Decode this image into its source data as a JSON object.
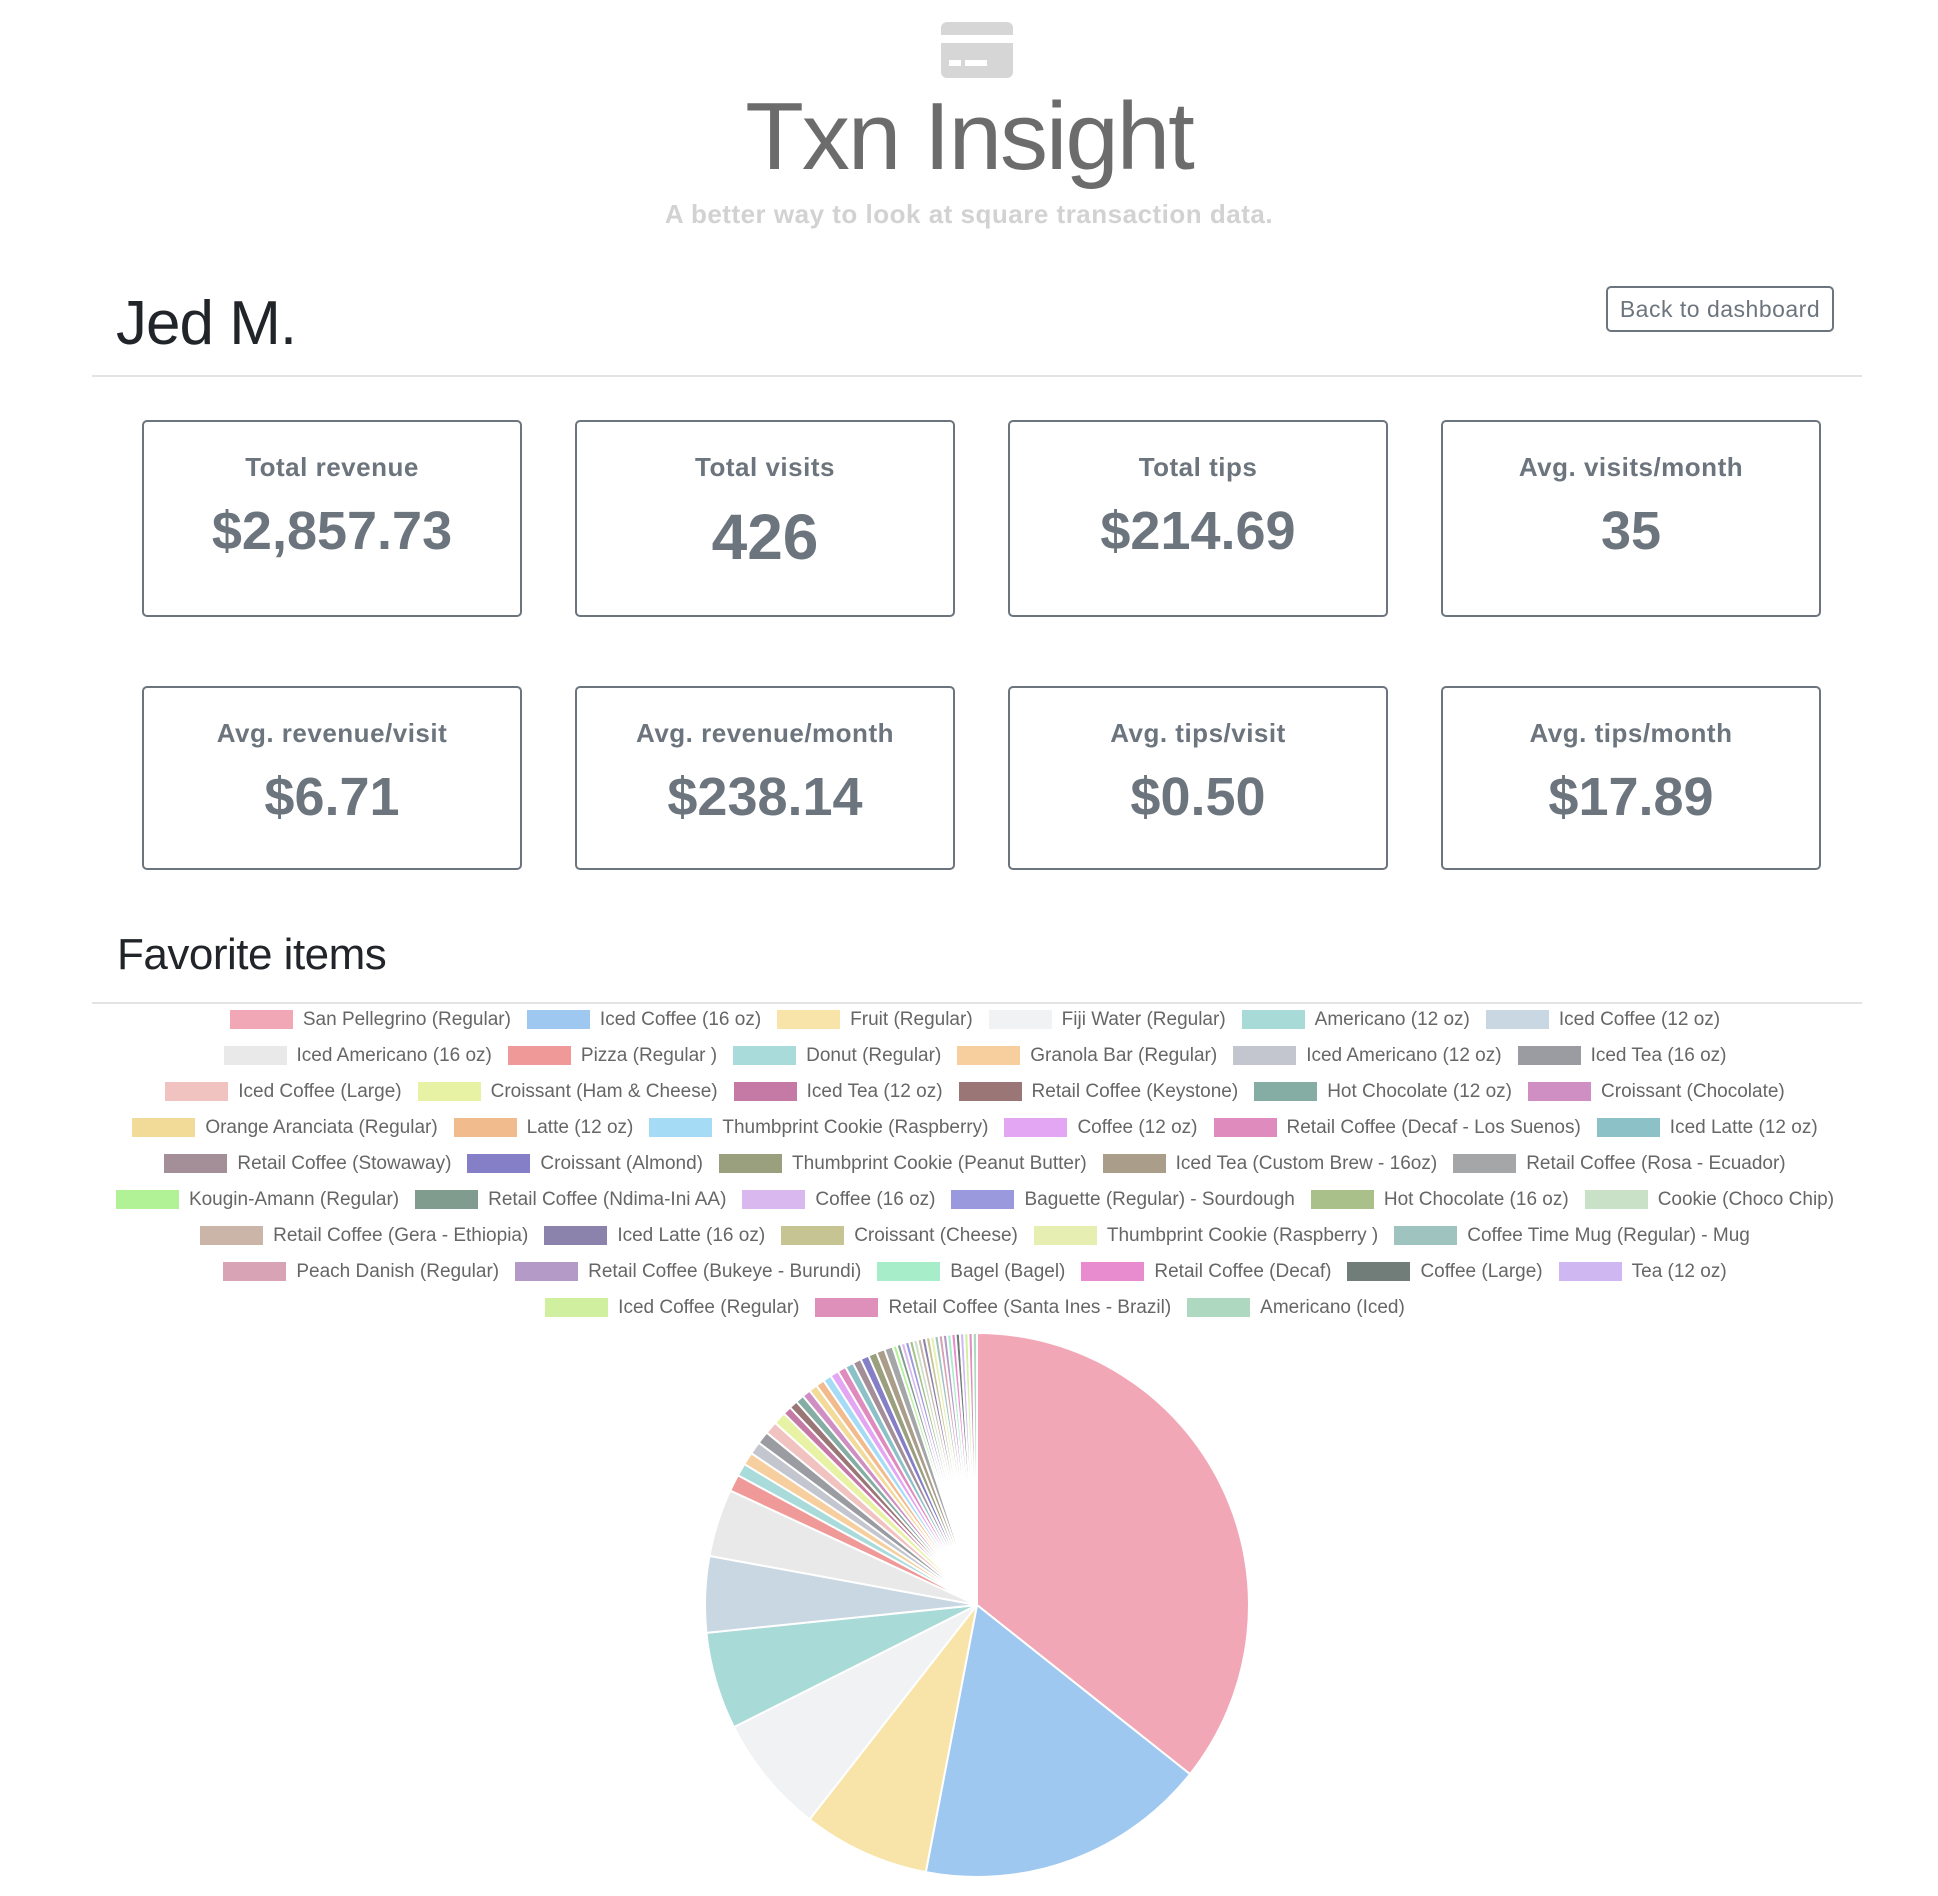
{
  "header": {
    "logo_icon": "credit-card-icon",
    "title": "Txn Insight",
    "subtitle": "A better way to look at square transaction data."
  },
  "customer": {
    "name": "Jed M.",
    "back_label": "Back to dashboard"
  },
  "stats": [
    {
      "label": "Total revenue",
      "value": "$2,857.73"
    },
    {
      "label": "Total visits",
      "value": "426"
    },
    {
      "label": "Total tips",
      "value": "$214.69"
    },
    {
      "label": "Avg. visits/month",
      "value": "35"
    },
    {
      "label": "Avg. revenue/visit",
      "value": "$6.71"
    },
    {
      "label": "Avg. revenue/month",
      "value": "$238.14"
    },
    {
      "label": "Avg. tips/visit",
      "value": "$0.50"
    },
    {
      "label": "Avg. tips/month",
      "value": "$17.89"
    }
  ],
  "favorites": {
    "title": "Favorite items"
  },
  "chart_data": {
    "type": "pie",
    "legend_position": "top",
    "categories": [
      "San Pellegrino (Regular)",
      "Iced Coffee (16 oz)",
      "Fruit (Regular)",
      "Fiji Water (Regular)",
      "Americano (12 oz)",
      "Iced Coffee (12 oz)",
      "Iced Americano (16 oz)",
      "Pizza (Regular )",
      "Donut (Regular)",
      "Granola Bar (Regular)",
      "Iced Americano (12 oz)",
      "Iced Tea (16 oz)",
      "Iced Coffee (Large)",
      "Croissant (Ham & Cheese)",
      "Iced Tea (12 oz)",
      "Retail Coffee (Keystone)",
      "Hot Chocolate (12 oz)",
      "Croissant (Chocolate)",
      "Orange Aranciata (Regular)",
      "Latte (12 oz)",
      "Thumbprint Cookie (Raspberry)",
      "Coffee (12 oz)",
      "Retail Coffee (Decaf - Los Suenos)",
      "Iced Latte (12 oz)",
      "Retail Coffee (Stowaway)",
      "Croissant (Almond)",
      "Thumbprint Cookie (Peanut Butter)",
      "Iced Tea (Custom Brew - 16oz)",
      "Retail Coffee (Rosa - Ecuador)",
      "Kougin-Amann (Regular)",
      "Retail Coffee (Ndima-Ini AA)",
      "Coffee (16 oz)",
      "Baguette (Regular) - Sourdough",
      "Hot Chocolate (16 oz)",
      "Cookie (Choco Chip)",
      "Retail Coffee (Gera - Ethiopia)",
      "Iced Latte (16 oz)",
      "Croissant (Cheese)",
      "Thumbprint Cookie (Raspberry )",
      "Coffee Time Mug (Regular) - Mug",
      "Peach Danish (Regular)",
      "Retail Coffee (Bukeye - Burundi)",
      "Bagel (Bagel)",
      "Retail Coffee (Decaf)",
      "Coffee (Large)",
      "Tea (12 oz)",
      "Iced Coffee (Regular)",
      "Retail Coffee (Santa Ines - Brazil)",
      "Americano (Iced)"
    ],
    "values": [
      142,
      69,
      30,
      28,
      23,
      18,
      16,
      4,
      3,
      3,
      3,
      3,
      3,
      3,
      2,
      2,
      2,
      2,
      2,
      2,
      2,
      2,
      2,
      2,
      2,
      2,
      2,
      2,
      2,
      1,
      1,
      1,
      1,
      1,
      1,
      1,
      1,
      1,
      1,
      1,
      1,
      1,
      1,
      1,
      1,
      1,
      1,
      1,
      1
    ],
    "colors": [
      "#f2a7b7",
      "#9ec8ef",
      "#f8e3a8",
      "#f1f2f3",
      "#a8dad8",
      "#c8d7e2",
      "#e9e9e9",
      "#ef9a98",
      "#a9dbdb",
      "#f7cf9e",
      "#c3c5cf",
      "#9a9ca2",
      "#f0c2c0",
      "#e8f2a4",
      "#c57aa5",
      "#9a7676",
      "#86ada3",
      "#d08fc3",
      "#f2da99",
      "#f2bb8d",
      "#a6dbf6",
      "#e3a6f2",
      "#e08bbd",
      "#8dc1c8",
      "#a48f98",
      "#857fc8",
      "#9aa07e",
      "#aa9e8a",
      "#a4a6a8",
      "#b2f297",
      "#7f9c8e",
      "#d8b8ef",
      "#9b99dd",
      "#a9c08a",
      "#c8e1c7",
      "#cbb5a8",
      "#8c83ad",
      "#c7c494",
      "#e6efb1",
      "#9fc3be",
      "#d8a4b5",
      "#b49ac7",
      "#a8edc9",
      "#e98ccf",
      "#717d79",
      "#cfb8f2",
      "#d0f0a0",
      "#de8fba",
      "#afd8c0"
    ]
  }
}
